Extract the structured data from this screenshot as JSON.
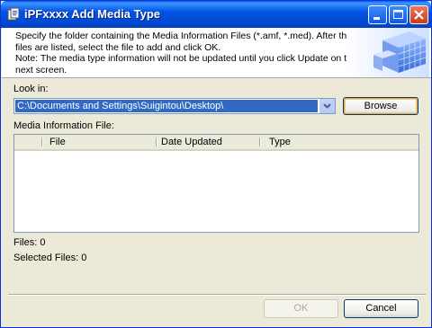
{
  "window": {
    "title": "iPFxxxx Add Media Type"
  },
  "header": {
    "lines": [
      "Specify the folder containing the Media Information Files (*.amf, *.med). After the",
      "files are listed, select the file to add and click OK.",
      "Note: The media type information will not be updated until you click Update on the",
      "next screen."
    ]
  },
  "look_in": {
    "label": "Look in:",
    "value": "C:\\Documents and Settings\\Suigintou\\Desktop\\"
  },
  "browse_label": "Browse",
  "media_list": {
    "label": "Media Information File:",
    "columns": [
      "File",
      "Date Updated",
      "Type"
    ],
    "rows": []
  },
  "status": {
    "files": "Files: 0",
    "selected_files": "Selected Files: 0"
  },
  "footer": {
    "ok_label": "OK",
    "cancel_label": "Cancel"
  },
  "colors": {
    "titlebar": "#0054e3",
    "selection": "#316ac5",
    "dialog_bg": "#ece9d8"
  }
}
